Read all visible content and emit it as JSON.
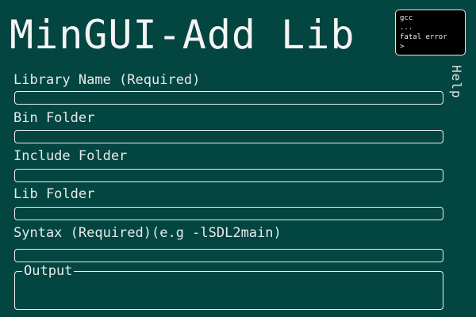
{
  "window": {
    "title": "MinGUI-Add Lib"
  },
  "terminal": {
    "lines": [
      "gcc",
      "...",
      "fatal error",
      ">"
    ]
  },
  "help": {
    "label": "Help"
  },
  "form": {
    "library_name": {
      "label": "Library Name (Required)",
      "value": ""
    },
    "bin_folder": {
      "label": "Bin Folder",
      "value": ""
    },
    "include_folder": {
      "label": "Include Folder",
      "value": ""
    },
    "lib_folder": {
      "label": "Lib Folder",
      "value": ""
    },
    "syntax": {
      "label": "Syntax (Required)(e.g -lSDL2main)",
      "value": ""
    }
  },
  "output": {
    "label": "Output",
    "text": ""
  },
  "colors": {
    "background": "#034540",
    "terminal_background": "#000000",
    "foreground": "#f2f2f2"
  }
}
